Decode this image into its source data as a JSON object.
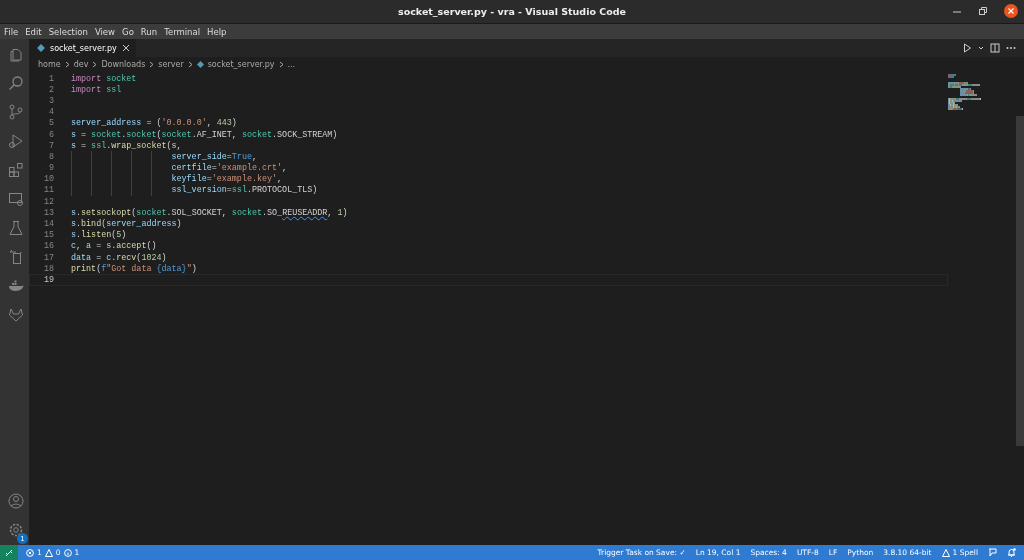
{
  "window": {
    "title": "socket_server.py - vra - Visual Studio Code"
  },
  "menu": [
    "File",
    "Edit",
    "Selection",
    "View",
    "Go",
    "Run",
    "Terminal",
    "Help"
  ],
  "tabs": [
    {
      "label": "socket_server.py",
      "selected": true
    }
  ],
  "breadcrumbs": [
    "home",
    "dev",
    "Downloads",
    "server",
    "socket_server.py",
    "..."
  ],
  "activity_bar": [
    {
      "kind": "files",
      "selected": false
    },
    {
      "kind": "search",
      "selected": false
    },
    {
      "kind": "git",
      "selected": false
    },
    {
      "kind": "debug",
      "selected": false
    },
    {
      "kind": "extensions",
      "selected": false
    },
    {
      "kind": "remote",
      "selected": false
    },
    {
      "kind": "flask",
      "selected": false
    },
    {
      "kind": "clipboard",
      "selected": false
    },
    {
      "kind": "whale",
      "selected": false
    },
    {
      "kind": "fox",
      "selected": false
    }
  ],
  "settings_badge": "1",
  "editor": {
    "lines": [
      {
        "number": "1",
        "current": false,
        "kind": "normal",
        "tokens": [
          {
            "kind": "keyword",
            "text": "import"
          },
          {
            "kind": "module",
            "text": " socket"
          }
        ]
      },
      {
        "number": "2",
        "current": false,
        "kind": "normal",
        "tokens": [
          {
            "kind": "keyword",
            "text": "import"
          },
          {
            "kind": "module",
            "text": " ssl"
          }
        ]
      },
      {
        "number": "3",
        "current": false,
        "kind": "normal"
      },
      {
        "number": "4",
        "current": false,
        "kind": "normal"
      },
      {
        "number": "5",
        "current": false,
        "kind": "normal",
        "tokens": [
          {
            "kind": "var",
            "text": "server_address"
          },
          {
            "kind": "plain",
            "text": " = ("
          },
          {
            "kind": "string",
            "text": "'0.0.0.0'"
          },
          {
            "kind": "plain",
            "text": ", "
          },
          {
            "kind": "number",
            "text": "443"
          },
          {
            "kind": "plain",
            "text": ")"
          }
        ]
      },
      {
        "number": "6",
        "current": false,
        "kind": "normal",
        "tokens": [
          {
            "kind": "var",
            "text": "s"
          },
          {
            "kind": "plain",
            "text": " = "
          },
          {
            "kind": "module",
            "text": "socket"
          },
          {
            "kind": "plain",
            "text": "."
          },
          {
            "kind": "module",
            "text": "socket"
          },
          {
            "kind": "plain",
            "text": "("
          },
          {
            "kind": "module",
            "text": "socket"
          },
          {
            "kind": "plain",
            "text": ".AF_INET, "
          },
          {
            "kind": "module",
            "text": "socket"
          },
          {
            "kind": "plain",
            "text": ".SOCK_STREAM)"
          }
        ]
      },
      {
        "number": "7",
        "current": false,
        "kind": "normal",
        "tokens": [
          {
            "kind": "var",
            "text": "s"
          },
          {
            "kind": "plain",
            "text": " = "
          },
          {
            "kind": "module",
            "text": "ssl"
          },
          {
            "kind": "plain",
            "text": "."
          },
          {
            "kind": "func",
            "text": "wrap_socket"
          },
          {
            "kind": "plain",
            "text": "(s,"
          }
        ]
      },
      {
        "number": "8",
        "current": false,
        "kind": "continuation",
        "tokens": [
          {
            "kind": "var",
            "text": "server_side"
          },
          {
            "kind": "plain",
            "text": "="
          },
          {
            "kind": "const",
            "text": "True"
          },
          {
            "kind": "plain",
            "text": ","
          }
        ]
      },
      {
        "number": "9",
        "current": false,
        "kind": "continuation",
        "tokens": [
          {
            "kind": "var",
            "text": "certfile"
          },
          {
            "kind": "plain",
            "text": "="
          },
          {
            "kind": "string",
            "text": "'example.crt'"
          },
          {
            "kind": "plain",
            "text": ","
          }
        ]
      },
      {
        "number": "10",
        "current": false,
        "kind": "continuation",
        "tokens": [
          {
            "kind": "var",
            "text": "keyfile"
          },
          {
            "kind": "plain",
            "text": "="
          },
          {
            "kind": "string",
            "text": "'example.key'"
          },
          {
            "kind": "plain",
            "text": ","
          }
        ]
      },
      {
        "number": "11",
        "current": false,
        "kind": "continuation",
        "tokens": [
          {
            "kind": "var",
            "text": "ssl_version"
          },
          {
            "kind": "plain",
            "text": "="
          },
          {
            "kind": "module",
            "text": "ssl"
          },
          {
            "kind": "plain",
            "text": ".PROTOCOL_TLS)"
          }
        ]
      },
      {
        "number": "12",
        "current": false,
        "kind": "normal"
      },
      {
        "number": "13",
        "current": false,
        "kind": "normal",
        "tokens": [
          {
            "kind": "var",
            "text": "s"
          },
          {
            "kind": "plain",
            "text": "."
          },
          {
            "kind": "func",
            "text": "setsockopt"
          },
          {
            "kind": "plain",
            "text": "("
          },
          {
            "kind": "module",
            "text": "socket"
          },
          {
            "kind": "plain",
            "text": ".SOL_SOCKET, "
          },
          {
            "kind": "module",
            "text": "socket"
          },
          {
            "kind": "plain",
            "text": ".SO_"
          },
          {
            "kind": "warning",
            "text": "REUSEADDR"
          },
          {
            "kind": "plain",
            "text": ", "
          },
          {
            "kind": "number",
            "text": "1"
          },
          {
            "kind": "plain",
            "text": ")"
          }
        ]
      },
      {
        "number": "14",
        "current": false,
        "kind": "normal",
        "tokens": [
          {
            "kind": "var",
            "text": "s"
          },
          {
            "kind": "plain",
            "text": "."
          },
          {
            "kind": "func",
            "text": "bind"
          },
          {
            "kind": "plain",
            "text": "("
          },
          {
            "kind": "var",
            "text": "server_address"
          },
          {
            "kind": "plain",
            "text": ")"
          }
        ]
      },
      {
        "number": "15",
        "current": false,
        "kind": "normal",
        "tokens": [
          {
            "kind": "var",
            "text": "s"
          },
          {
            "kind": "plain",
            "text": "."
          },
          {
            "kind": "func",
            "text": "listen"
          },
          {
            "kind": "plain",
            "text": "("
          },
          {
            "kind": "number",
            "text": "5"
          },
          {
            "kind": "plain",
            "text": ")"
          }
        ]
      },
      {
        "number": "16",
        "current": false,
        "kind": "normal",
        "tokens": [
          {
            "kind": "var",
            "text": "c"
          },
          {
            "kind": "plain",
            "text": ", "
          },
          {
            "kind": "var",
            "text": "a"
          },
          {
            "kind": "plain",
            "text": " = "
          },
          {
            "kind": "var",
            "text": "s"
          },
          {
            "kind": "plain",
            "text": "."
          },
          {
            "kind": "func",
            "text": "accept"
          },
          {
            "kind": "plain",
            "text": "()"
          }
        ]
      },
      {
        "number": "17",
        "current": false,
        "kind": "normal",
        "tokens": [
          {
            "kind": "var",
            "text": "data"
          },
          {
            "kind": "plain",
            "text": " = "
          },
          {
            "kind": "var",
            "text": "c"
          },
          {
            "kind": "plain",
            "text": "."
          },
          {
            "kind": "func",
            "text": "recv"
          },
          {
            "kind": "plain",
            "text": "("
          },
          {
            "kind": "number",
            "text": "1024"
          },
          {
            "kind": "plain",
            "text": ")"
          }
        ]
      },
      {
        "number": "18",
        "current": false,
        "kind": "normal",
        "tokens": [
          {
            "kind": "func",
            "text": "print"
          },
          {
            "kind": "plain",
            "text": "("
          },
          {
            "kind": "const",
            "text": "f"
          },
          {
            "kind": "string",
            "text": "\"Got data "
          },
          {
            "kind": "const",
            "text": "{data}"
          },
          {
            "kind": "string",
            "text": "\""
          },
          {
            "kind": "plain",
            "text": ")"
          }
        ]
      },
      {
        "number": "19",
        "current": true,
        "kind": "normal"
      }
    ]
  },
  "status_bar": {
    "errors": "1",
    "warnings": "0",
    "infos": "1",
    "right": [
      {
        "kind": "text",
        "text": "Trigger Task on Save: ✓"
      },
      {
        "kind": "text",
        "text": "Ln 19, Col 1"
      },
      {
        "kind": "text",
        "text": "Spaces: 4"
      },
      {
        "kind": "text",
        "text": "UTF-8"
      },
      {
        "kind": "text",
        "text": "LF"
      },
      {
        "kind": "text",
        "text": "Python"
      },
      {
        "kind": "text",
        "text": "3.8.10 64-bit"
      },
      {
        "kind": "warning",
        "text": "1 Spell"
      }
    ]
  }
}
